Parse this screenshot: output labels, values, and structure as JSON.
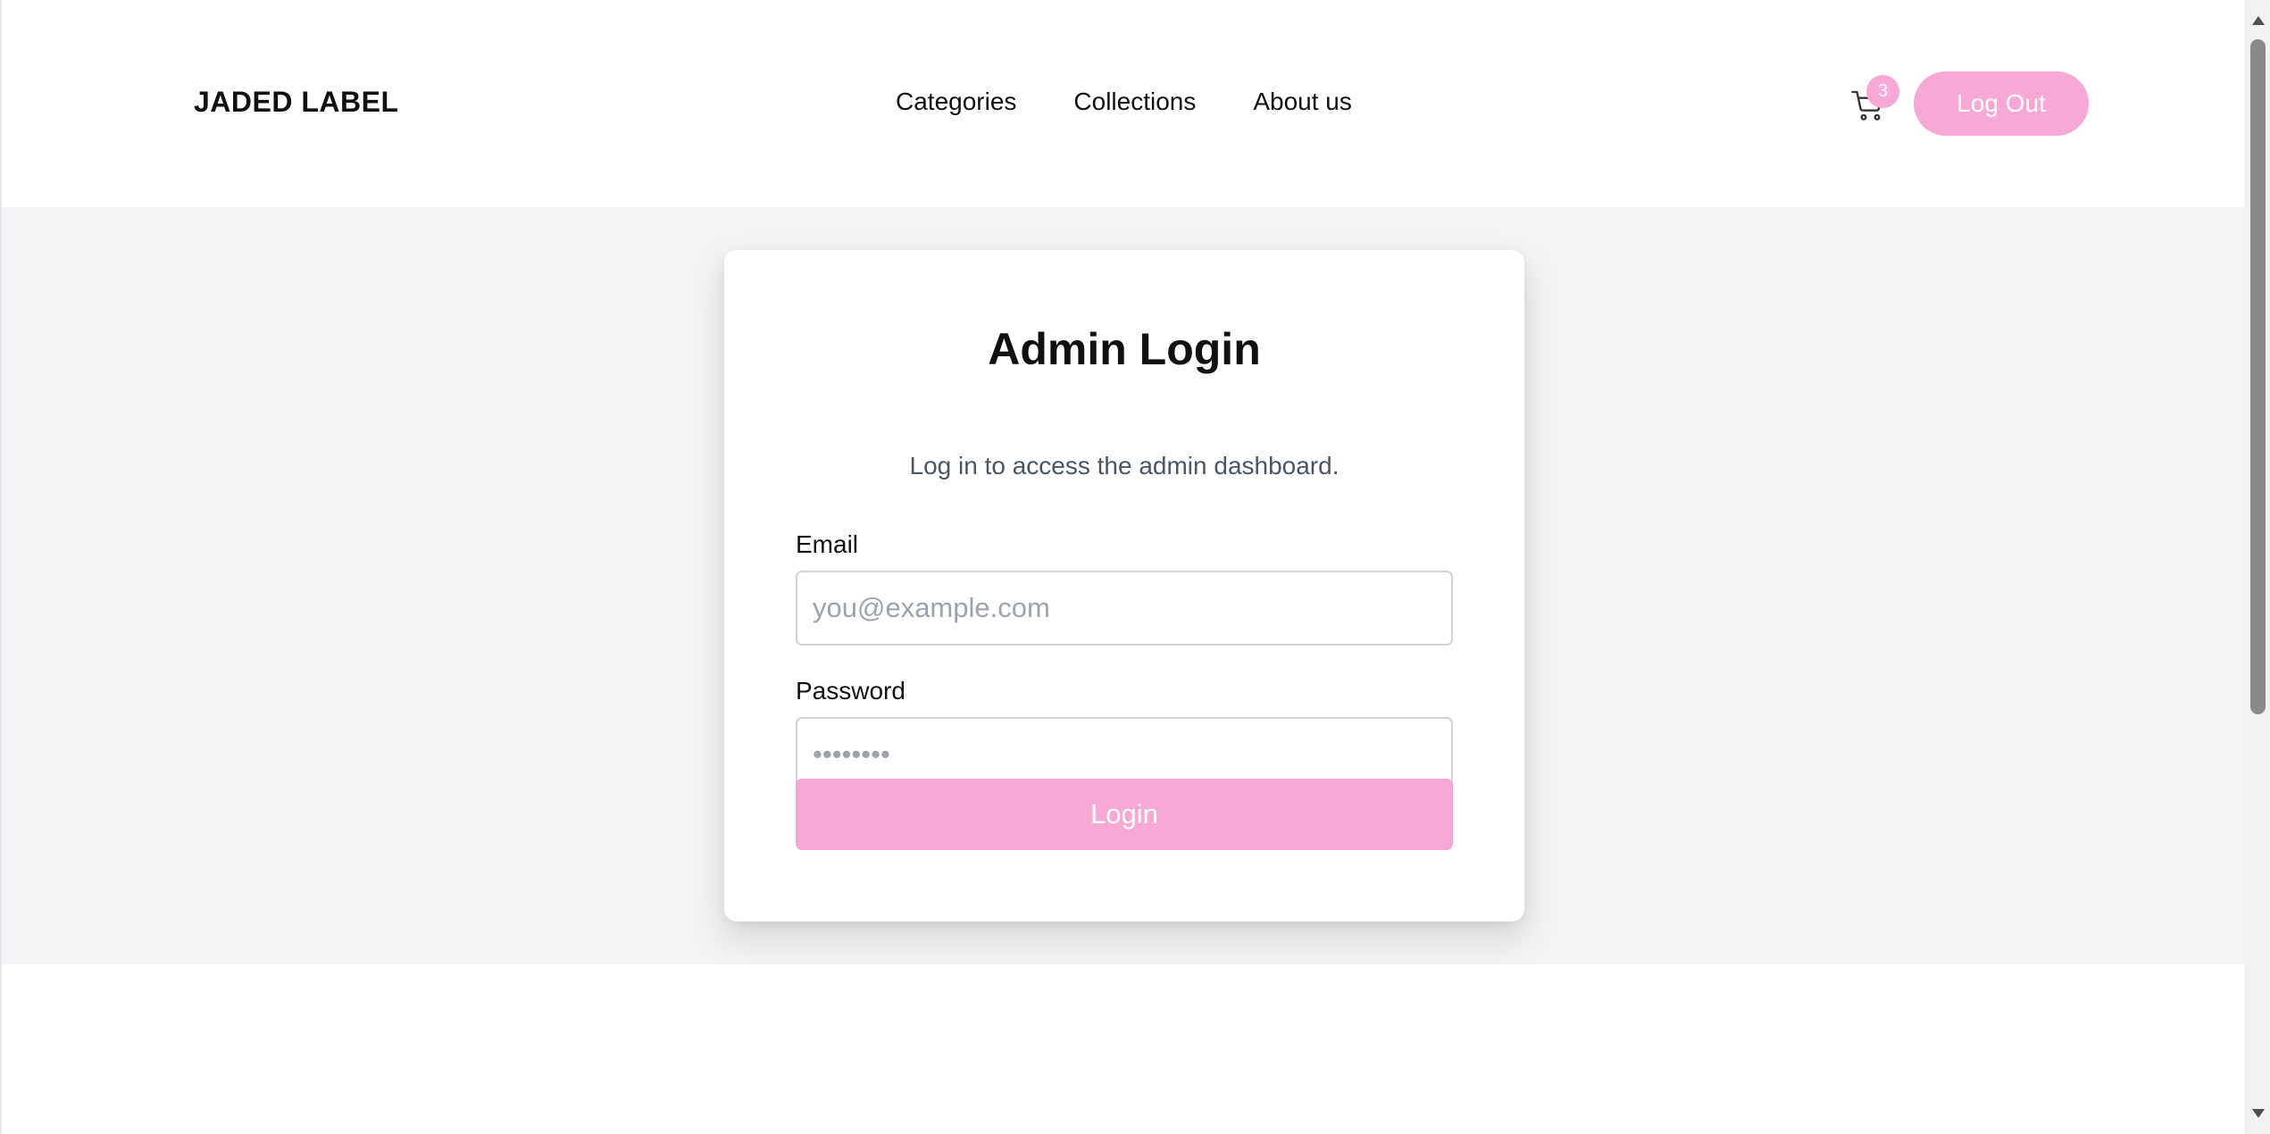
{
  "header": {
    "logo": "JADED LABEL",
    "nav": [
      "Categories",
      "Collections",
      "About us"
    ],
    "cart_count": "3",
    "logout_label": "Log Out"
  },
  "login": {
    "title": "Admin Login",
    "subtitle": "Log in to access the admin dashboard.",
    "email_label": "Email",
    "email_placeholder": "you@example.com",
    "email_value": "",
    "password_label": "Password",
    "password_placeholder": "••••••••",
    "password_value": "",
    "submit_label": "Login"
  },
  "colors": {
    "accent": "#f8a8d4",
    "page_bg": "#f2f3f5",
    "card_bg": "#ffffff",
    "text": "#111111",
    "muted_text": "#4b5563"
  },
  "icons": {
    "cart": "cart-icon",
    "scroll_up": "scroll-up-arrow-icon",
    "scroll_down": "scroll-down-arrow-icon"
  }
}
